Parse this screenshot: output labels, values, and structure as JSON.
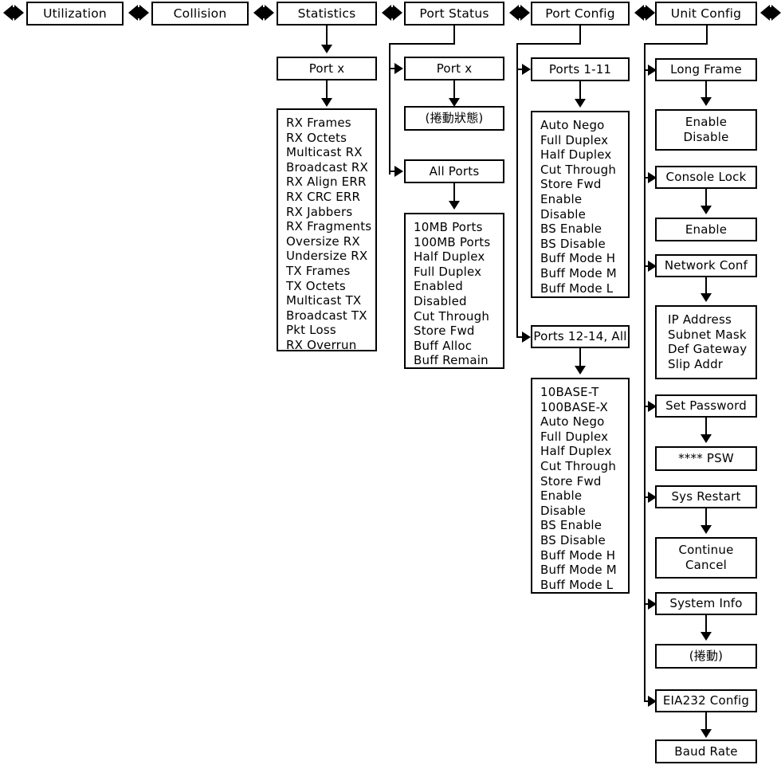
{
  "diagram": {
    "title": "Switch LCD Menu Tree",
    "line_color": "#000000",
    "background": "#ffffff"
  },
  "top_tabs": [
    {
      "label": "Utilization"
    },
    {
      "label": "Collision"
    },
    {
      "label": "Statistics"
    },
    {
      "label": "Port Status"
    },
    {
      "label": "Port Config"
    },
    {
      "label": "Unit Config"
    }
  ],
  "arrows": {
    "left_right_icon": "left-right-double-arrow-icon",
    "down_icon": "arrow-down-icon",
    "right_icon": "arrow-right-icon"
  },
  "statistics_branch": {
    "port_node": "Port x",
    "counters": [
      "RX Frames",
      "RX Octets",
      "Multicast RX",
      "Broadcast RX",
      "RX Align ERR",
      "RX CRC ERR",
      "RX Jabbers",
      "RX Fragments",
      "Oversize RX",
      "Undersize RX",
      "TX Frames",
      "TX Octets",
      "Multicast TX",
      "Broadcast TX",
      "Pkt Loss",
      "RX Overrun"
    ]
  },
  "port_status_branch": {
    "port_node": "Port x",
    "port_scroll": "(捲動狀態)",
    "all_ports_node": "All Ports",
    "all_ports_items": [
      "10MB Ports",
      "100MB Ports",
      "Half Duplex",
      "Full Duplex",
      "Enabled",
      "Disabled",
      "Cut Through",
      "Store Fwd",
      "Buff Alloc",
      "Buff Remain"
    ]
  },
  "port_config_branch": {
    "ports_1_11_node": "Ports 1-11",
    "ports_1_11_items": [
      "Auto Nego",
      "Full Duplex",
      "Half Duplex",
      "Cut Through",
      "Store Fwd",
      "Enable",
      "Disable",
      "BS Enable",
      "BS Disable",
      "Buff Mode H",
      "Buff Mode M",
      "Buff Mode L"
    ],
    "ports_12_14_node": "Ports 12-14, All",
    "ports_12_14_items": [
      "10BASE-T",
      "100BASE-X",
      "Auto Nego",
      "Full Duplex",
      "Half Duplex",
      "Cut Through",
      "Store Fwd",
      "Enable",
      "Disable",
      "BS Enable",
      "BS Disable",
      "Buff Mode H",
      "Buff Mode M",
      "Buff Mode L"
    ]
  },
  "unit_config_branch": {
    "long_frame_node": "Long Frame",
    "long_frame_items": [
      "Enable",
      "Disable"
    ],
    "console_lock_node": "Console Lock",
    "console_lock_items": [
      "Enable"
    ],
    "network_conf_node": "Network Conf",
    "network_conf_items": [
      "IP Address",
      "Subnet Mask",
      "Def Gateway",
      "Slip Addr"
    ],
    "set_password_node": "Set Password",
    "set_password_items": [
      "**** PSW"
    ],
    "sys_restart_node": "Sys Restart",
    "sys_restart_items": [
      "Continue",
      "Cancel"
    ],
    "system_info_node": "System Info",
    "system_info_items": [
      "(捲動)"
    ],
    "eia232_node": "EIA232 Config",
    "eia232_items": [
      "Baud Rate"
    ]
  }
}
